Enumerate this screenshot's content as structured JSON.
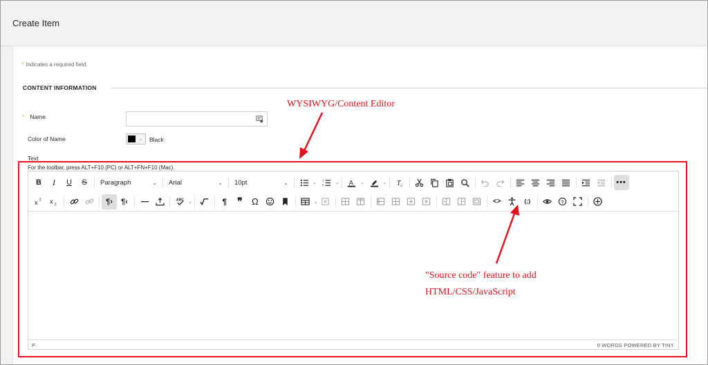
{
  "header": {
    "title": "Create Item"
  },
  "form": {
    "required_note": "Indicates a required field.",
    "required_mark": "*",
    "section_title": "CONTENT INFORMATION",
    "name_label": "Name",
    "name_value": "",
    "color_label": "Color of Name",
    "color_value": "Black",
    "color_hex": "#000000",
    "text_label": "Text",
    "toolbar_hint": "For the toolbar, press ALT+F10 (PC) or ALT+FN+F10 (Mac)."
  },
  "editor": {
    "block_format": "Paragraph",
    "font_family": "Arial",
    "font_size": "10pt",
    "status_path": "P",
    "status_words": "0 WORDS  POWERED BY TINY",
    "icons_row1": [
      "bold-icon",
      "italic-icon",
      "underline-icon",
      "strikethrough-icon",
      "bullet-list-icon",
      "numbered-list-icon",
      "text-color-icon",
      "highlight-color-icon",
      "clear-formatting-icon",
      "cut-icon",
      "copy-icon",
      "paste-icon",
      "find-replace-icon",
      "undo-icon",
      "redo-icon",
      "align-left-icon",
      "align-center-icon",
      "align-right-icon",
      "justify-icon",
      "indent-icon",
      "outdent-icon",
      "more-icon"
    ],
    "icons_row2": [
      "superscript-icon",
      "subscript-icon",
      "link-icon",
      "unlink-icon",
      "ltr-icon",
      "rtl-icon",
      "horizontal-rule-icon",
      "insert-file-icon",
      "spellcheck-icon",
      "math-icon",
      "paragraph-mark-icon",
      "blockquote-icon",
      "special-char-icon",
      "emoji-icon",
      "bookmark-icon",
      "table-icon",
      "table-delete-icon",
      "source-code-icon",
      "accessibility-icon",
      "code-sample-icon",
      "preview-icon",
      "help-icon",
      "fullscreen-icon",
      "add-content-icon"
    ]
  },
  "annotations": {
    "editor_label": "WYSIWYG/Content Editor",
    "source_line1": "\"Source code\" feature to add",
    "source_line2": "HTML/CSS/JavaScript",
    "color": "#e3121a"
  },
  "colors": {
    "required_star": "#e9a41c",
    "header_bg": "#f2f2f2",
    "active_button_bg": "#dedede"
  }
}
